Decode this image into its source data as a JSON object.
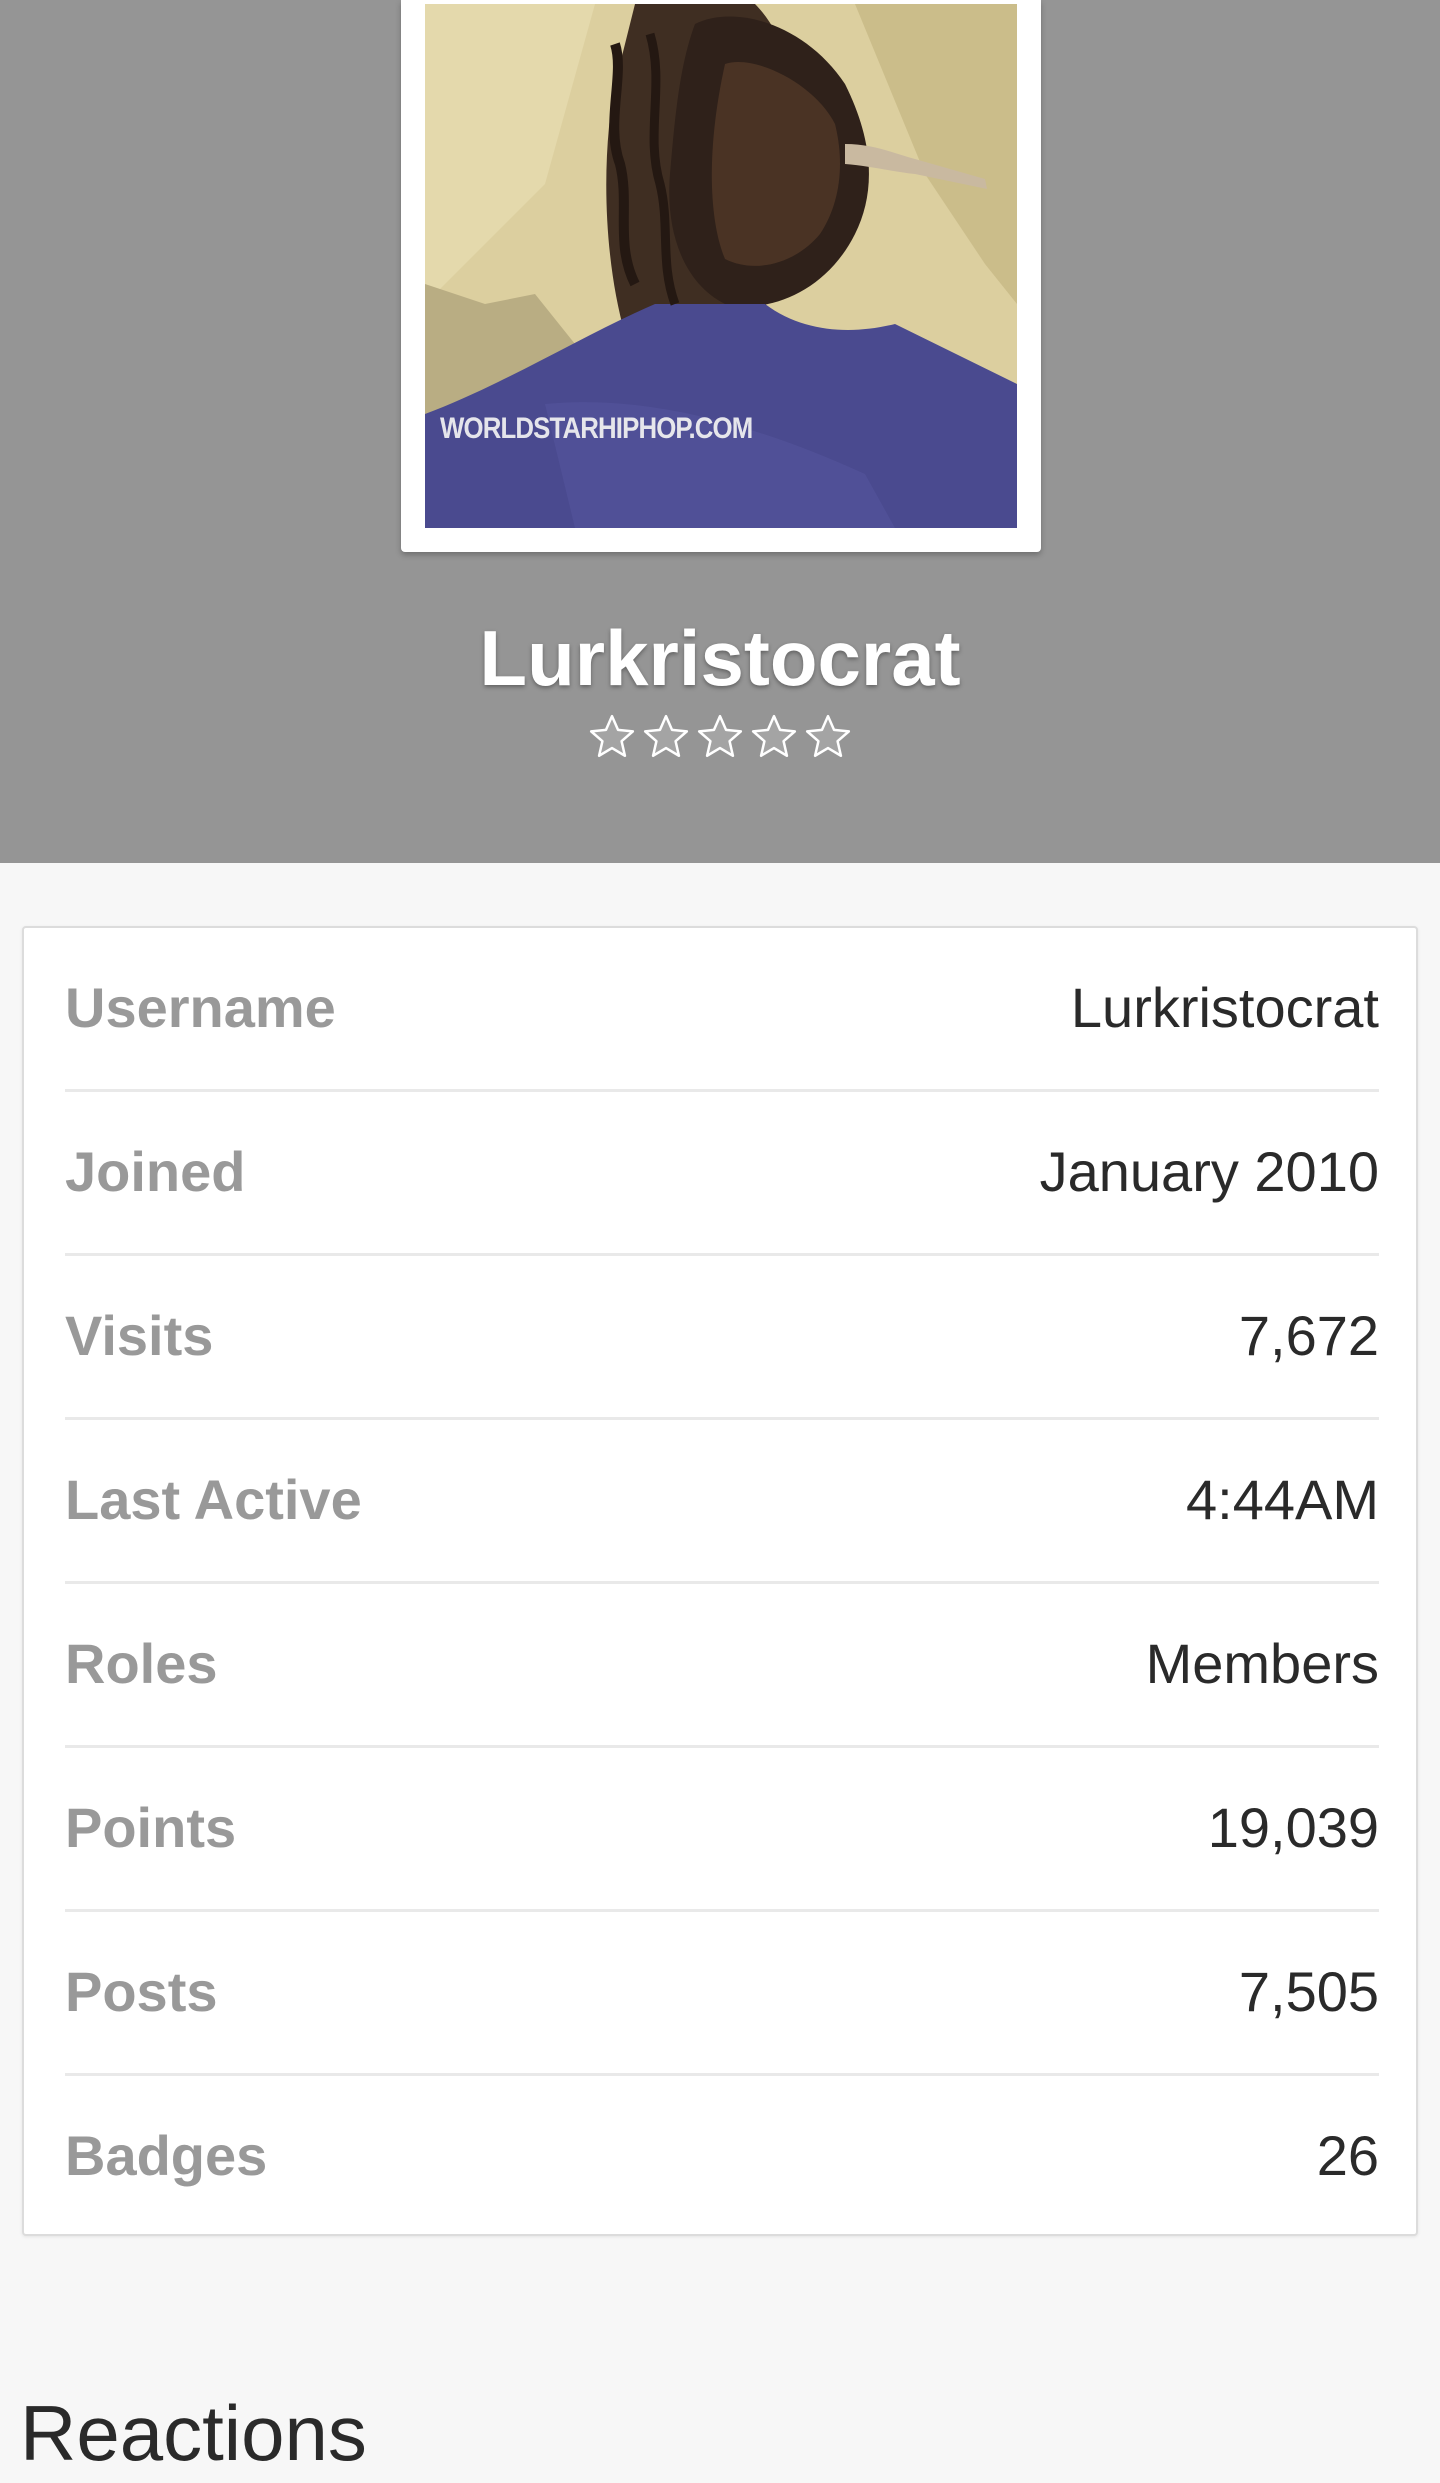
{
  "profile": {
    "name": "Lurkristocrat",
    "avatar_watermark": "WORLDSTARHIPHOP.COM",
    "rating_stars": 5,
    "rating_filled": 0
  },
  "info": {
    "rows": [
      {
        "label": "Username",
        "value": "Lurkristocrat"
      },
      {
        "label": "Joined",
        "value": "January 2010"
      },
      {
        "label": "Visits",
        "value": "7,672"
      },
      {
        "label": "Last Active",
        "value": "4:44AM"
      },
      {
        "label": "Roles",
        "value": "Members"
      },
      {
        "label": "Points",
        "value": "19,039"
      },
      {
        "label": "Posts",
        "value": "7,505"
      },
      {
        "label": "Badges",
        "value": "26"
      }
    ]
  },
  "sections": {
    "reactions_title": "Reactions"
  },
  "colors": {
    "header_bg": "#959595",
    "page_bg": "#f7f7f7",
    "label_text": "#999999",
    "value_text": "#2a2a2a"
  }
}
